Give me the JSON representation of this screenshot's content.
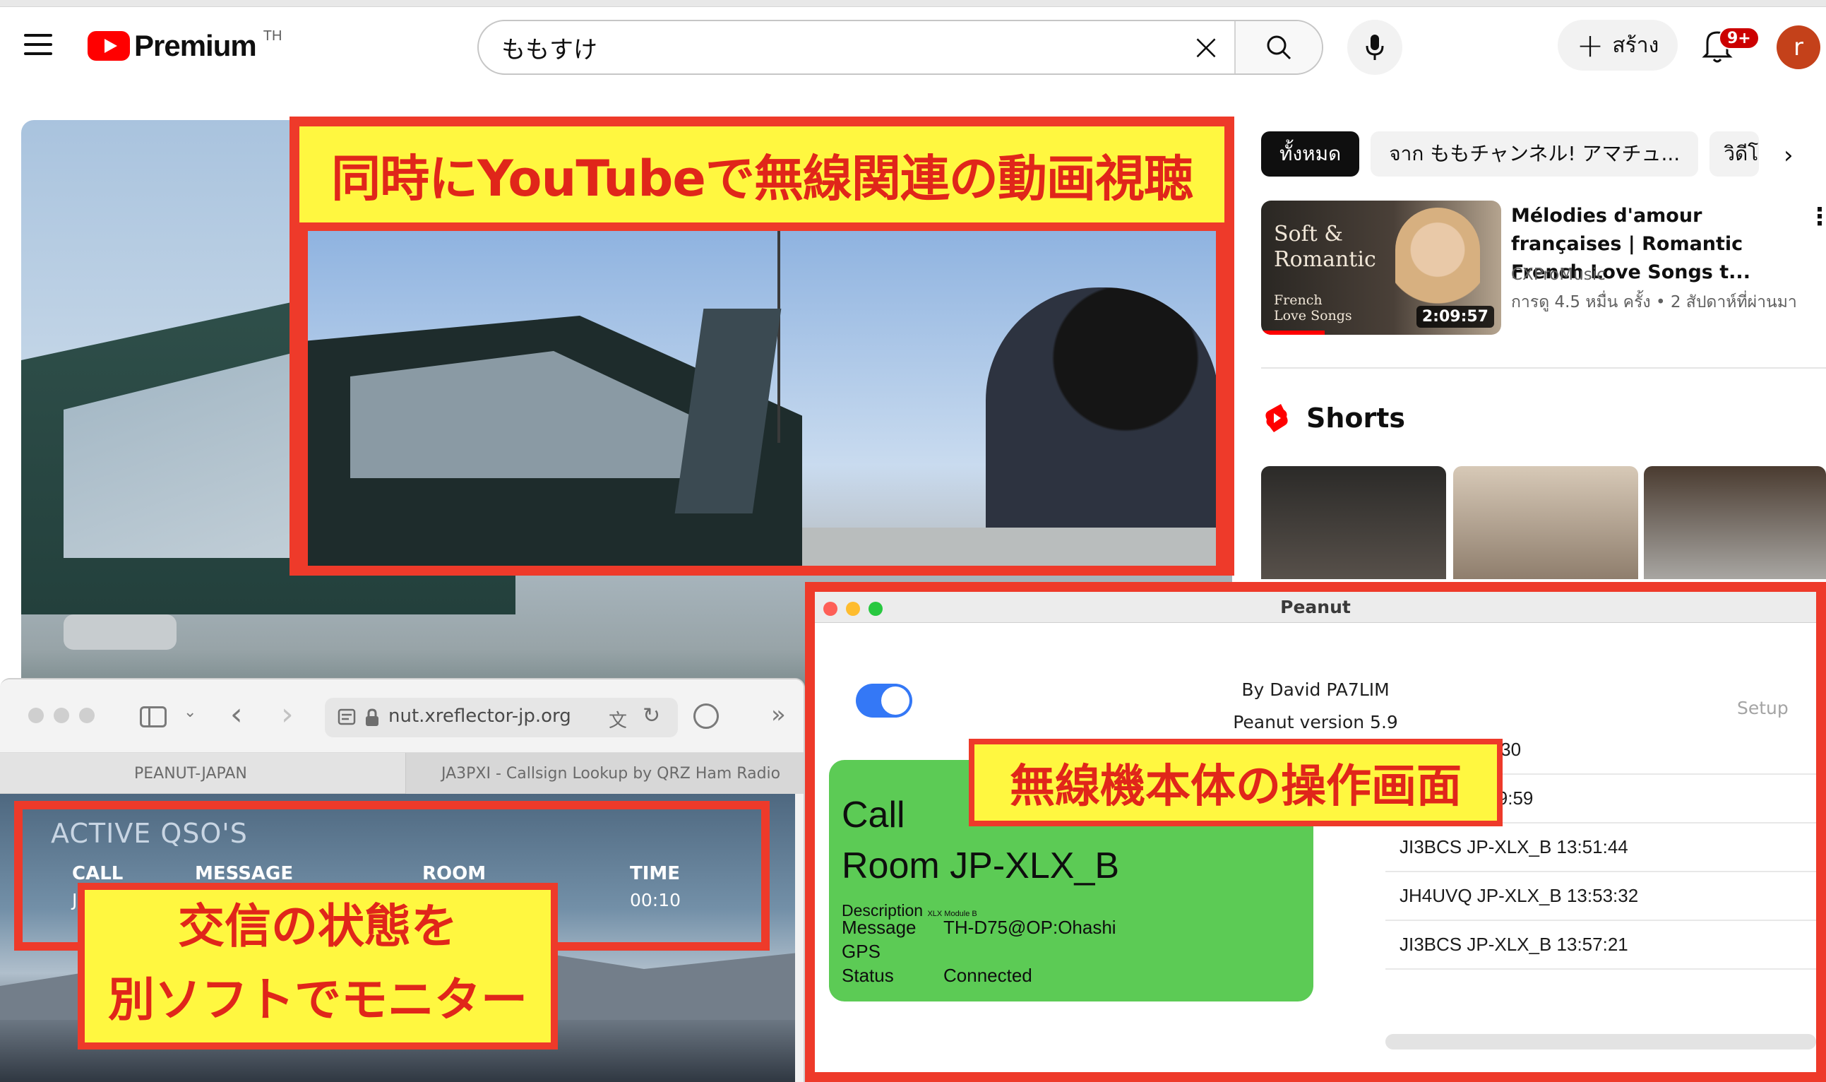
{
  "youtube": {
    "brand": "Premium",
    "country": "TH",
    "search_value": "ももすけ",
    "create_label": "สร้าง",
    "notification_count": "9+",
    "avatar_letter": "r",
    "accent_color": "#ff0000"
  },
  "video_overlay": {
    "title": "同時にYouTubeで無線関連の動画視聴"
  },
  "sidebar": {
    "chips": [
      "ทั้งหมด",
      "จาก ももチャンネル! アマチュ...",
      "วิดีโอ"
    ],
    "recommended": {
      "thumb_title": "Soft & Romantic",
      "thumb_subtitle": "French Love Songs",
      "duration": "2:09:57",
      "title": "Mélodies d'amour françaises | Romantic French Love Songs t...",
      "channel": "CXProMusic",
      "meta": "การดู 4.5 หมื่น ครั้ง  • 2 สัปดาห์ที่ผ่านมา"
    },
    "shorts_title": "Shorts"
  },
  "peanut": {
    "window_title": "Peanut",
    "author": "By David PA7LIM",
    "version": "Peanut version 5.9",
    "setup_label": "Setup",
    "toggle_on": true,
    "card": {
      "call_label": "Call",
      "room": "Room JP-XLX_B",
      "description_label": "Description",
      "description_small": "XLX Module B",
      "rows": [
        {
          "key": "Message",
          "value": "TH-D75@OP:Ohashi"
        },
        {
          "key": "GPS",
          "value": ""
        },
        {
          "key": "Status",
          "value": "Connected"
        }
      ]
    },
    "list": [
      "LX_B 13:47:30",
      "XLX_B 13:49:59",
      "JI3BCS JP-XLX_B 13:51:44",
      "JH4UVQ JP-XLX_B 13:53:32",
      "JI3BCS JP-XLX_B 13:57:21"
    ],
    "overlay_label": "無線機本体の操作画面"
  },
  "safari": {
    "url": "nut.xreflector-jp.org",
    "tabs": [
      "PEANUT-JAPAN",
      "JA3PXI - Callsign Lookup by QRZ Ham Radio"
    ],
    "qso_title": "ACTIVE QSO'S",
    "columns": [
      "CALL",
      "MESSAGE",
      "ROOM",
      "TIME"
    ],
    "row_call": "J",
    "row_time": "00:10",
    "overlay_line1": "交信の状態を",
    "overlay_line2": "別ソフトでモニター"
  },
  "colors": {
    "annotation_red": "#ee3a2a",
    "annotation_yellow": "#fff740",
    "toggle_blue": "#3478f6",
    "card_green": "#5ccb55"
  }
}
